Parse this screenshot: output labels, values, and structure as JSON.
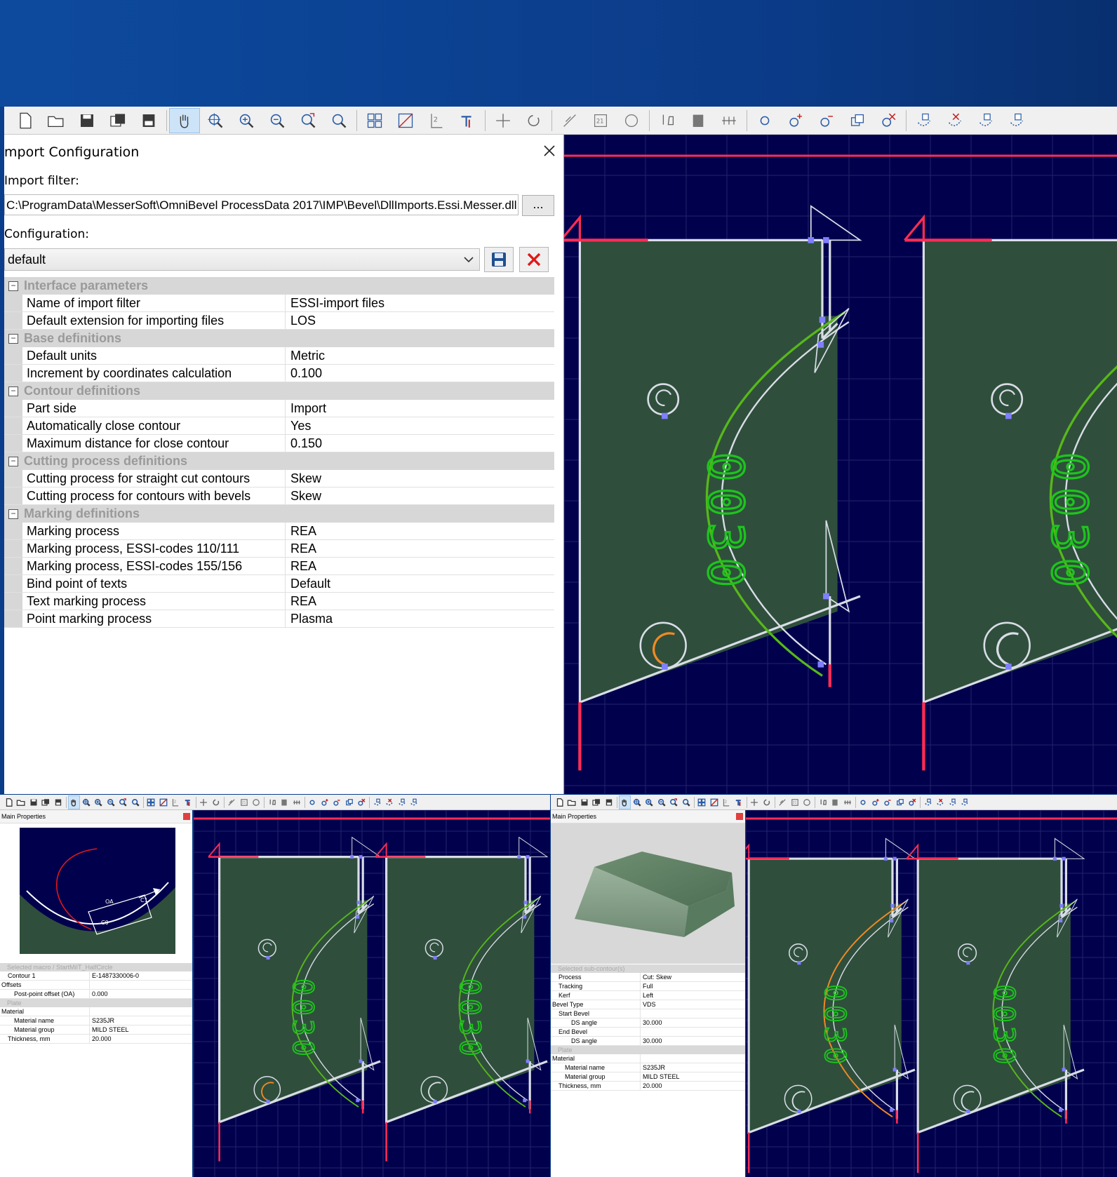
{
  "dialog": {
    "title": "mport Configuration",
    "import_filter_label": "Import filter:",
    "import_filter_path": "C:\\ProgramData\\MesserSoft\\OmniBevel ProcessData 2017\\IMP\\Bevel\\DllImports.Essi.Messer.dll",
    "browse_label": "...",
    "configuration_label": "Configuration:",
    "configuration_value": "default",
    "categories": [
      {
        "title": "Interface parameters",
        "rows": [
          {
            "key": "Name of import filter",
            "value": "ESSI-import files"
          },
          {
            "key": "Default extension for importing files",
            "value": "LOS"
          }
        ]
      },
      {
        "title": "Base definitions",
        "rows": [
          {
            "key": "Default units",
            "value": "Metric"
          },
          {
            "key": "Increment by coordinates calculation",
            "value": "0.100"
          }
        ]
      },
      {
        "title": "Contour definitions",
        "rows": [
          {
            "key": "Part side",
            "value": "Import"
          },
          {
            "key": "Automatically close contour",
            "value": "Yes"
          },
          {
            "key": "Maximum distance for close contour",
            "value": "0.150"
          }
        ]
      },
      {
        "title": "Cutting process definitions",
        "rows": [
          {
            "key": "Cutting process for straight cut contours",
            "value": "Skew"
          },
          {
            "key": "Cutting process for contours with bevels",
            "value": "Skew"
          }
        ]
      },
      {
        "title": "Marking definitions",
        "rows": [
          {
            "key": "Marking process",
            "value": "REA"
          },
          {
            "key": "Marking process, ESSI-codes 110/111",
            "value": "REA"
          },
          {
            "key": "Marking process, ESSI-codes 155/156",
            "value": "REA"
          },
          {
            "key": "Bind point of texts",
            "value": "Default"
          },
          {
            "key": "Text marking process",
            "value": "REA"
          },
          {
            "key": "Point marking process",
            "value": "Plasma"
          }
        ]
      }
    ]
  },
  "part_text": "0030",
  "left_panel": {
    "title": "Main Properties",
    "preview_labels": {
      "oa": "OA",
      "c1": "C1",
      "c0": "C0"
    },
    "rows": [
      {
        "type": "cat",
        "text": "Selected macro / StartMiIT_HalfCircle"
      },
      {
        "type": "row",
        "indent": 1,
        "key": "Contour 1",
        "value": "E-1487330006-0"
      },
      {
        "type": "row",
        "indent": 0,
        "key": "Offsets",
        "value": ""
      },
      {
        "type": "row",
        "indent": 2,
        "key": "Post-point offset (OA)",
        "value": "0.000"
      },
      {
        "type": "cat",
        "text": "Plate"
      },
      {
        "type": "row",
        "indent": 0,
        "key": "Material",
        "value": ""
      },
      {
        "type": "row",
        "indent": 2,
        "key": "Material name",
        "value": "S235JR"
      },
      {
        "type": "row",
        "indent": 2,
        "key": "Material group",
        "value": "MILD STEEL"
      },
      {
        "type": "row",
        "indent": 1,
        "key": "Thickness, mm",
        "value": "20.000"
      }
    ]
  },
  "right_panel": {
    "title": "Main Properties",
    "rows": [
      {
        "type": "cat",
        "text": "Selected sub-contour(s)"
      },
      {
        "type": "row",
        "indent": 1,
        "key": "Process",
        "value": "Cut: Skew"
      },
      {
        "type": "row",
        "indent": 1,
        "key": "Tracking",
        "value": "Full"
      },
      {
        "type": "row",
        "indent": 1,
        "key": "Kerf",
        "value": "Left"
      },
      {
        "type": "row",
        "indent": 0,
        "key": "Bevel Type",
        "value": "VDS"
      },
      {
        "type": "row",
        "indent": 1,
        "key": "Start Bevel",
        "value": ""
      },
      {
        "type": "row",
        "indent": 3,
        "key": "DS angle",
        "value": "30.000"
      },
      {
        "type": "row",
        "indent": 1,
        "key": "End Bevel",
        "value": ""
      },
      {
        "type": "row",
        "indent": 3,
        "key": "DS angle",
        "value": "30.000"
      },
      {
        "type": "cat",
        "text": "Plate"
      },
      {
        "type": "row",
        "indent": 0,
        "key": "Material",
        "value": ""
      },
      {
        "type": "row",
        "indent": 2,
        "key": "Material name",
        "value": "S235JR"
      },
      {
        "type": "row",
        "indent": 2,
        "key": "Material group",
        "value": "MILD STEEL"
      },
      {
        "type": "row",
        "indent": 1,
        "key": "Thickness, mm",
        "value": "20.000"
      }
    ]
  },
  "toolbar": {
    "groups": [
      [
        "new-file-icon",
        "open-folder-icon",
        "save-icon",
        "save-all-icon",
        "save-as-icon"
      ],
      [
        "pan-hand-icon",
        "zoom-fit-icon",
        "zoom-in-icon",
        "zoom-out-icon",
        "zoom-window-icon",
        "zoom-previous-icon"
      ],
      [
        "grid-view-icon",
        "hatch-icon",
        "dimension-icon",
        "bevel-tool-icon"
      ],
      [
        "move-icon",
        "rotate-icon"
      ],
      [
        "lead-icon",
        "numbering-icon",
        "circle-tool-icon"
      ],
      [
        "cut-icon",
        "paste-icon",
        "measure-icon"
      ],
      [
        "circle-icon",
        "circle-add-icon",
        "circle-edit-icon",
        "contour-copy-icon",
        "contour-delete-icon"
      ],
      [
        "node-icon",
        "node-delete-icon",
        "node-copy-icon",
        "node-paste-icon"
      ]
    ],
    "active": "pan-hand-icon"
  },
  "colors": {
    "cad_bg": "#00004d",
    "plate": "#2f4f3c",
    "contour": "#d9dde6",
    "bevel_green": "#58b81a",
    "selected_orange": "#f08a24",
    "limit_red": "#ff2d55",
    "node": "#7f7fff",
    "text_green": "#1dc41d"
  }
}
